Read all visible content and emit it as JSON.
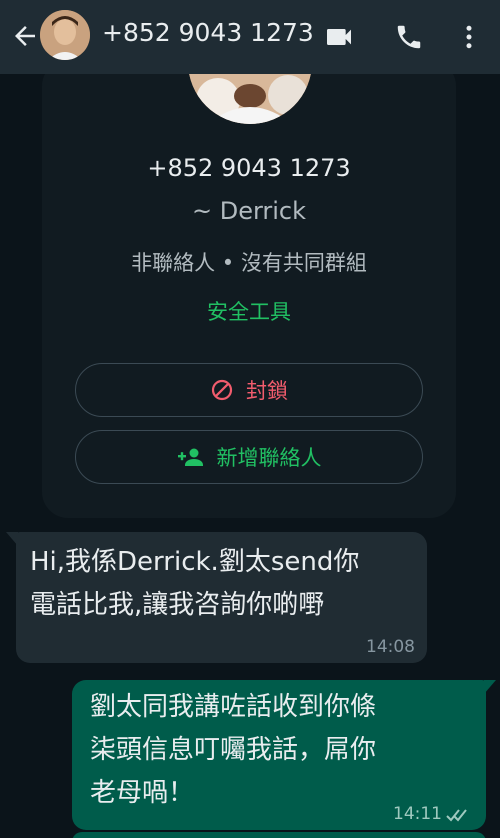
{
  "header": {
    "title": "+852 9043 1273",
    "back_icon": "arrow-left-icon",
    "video_icon": "video-call-icon",
    "call_icon": "phone-icon",
    "menu_icon": "more-vertical-icon"
  },
  "contact_card": {
    "phone": "+852 9043 1273",
    "name": "~ Derrick",
    "info": "非聯絡人 • 沒有共同群組",
    "safety_tools": "安全工具",
    "block_label": "封鎖",
    "add_contact_label": "新增聯絡人"
  },
  "messages": [
    {
      "direction": "incoming",
      "lines": [
        "Hi,我係Derrick.劉太send你",
        "電話比我,讓我咨詢你啲嘢"
      ],
      "time": "14:08"
    },
    {
      "direction": "outgoing",
      "lines": [
        "劉太同我講咗話收到你條",
        "柒頭信息叮囑我話，屌你",
        "老母喎！"
      ],
      "time": "14:11",
      "status": "read"
    }
  ],
  "colors": {
    "header_bg": "#1f2c34",
    "chat_bg": "#0b141a",
    "incoming_bubble": "#202c33",
    "outgoing_bubble": "#005c4b",
    "accent_green": "#21c063",
    "block_red": "#f15c6d"
  }
}
